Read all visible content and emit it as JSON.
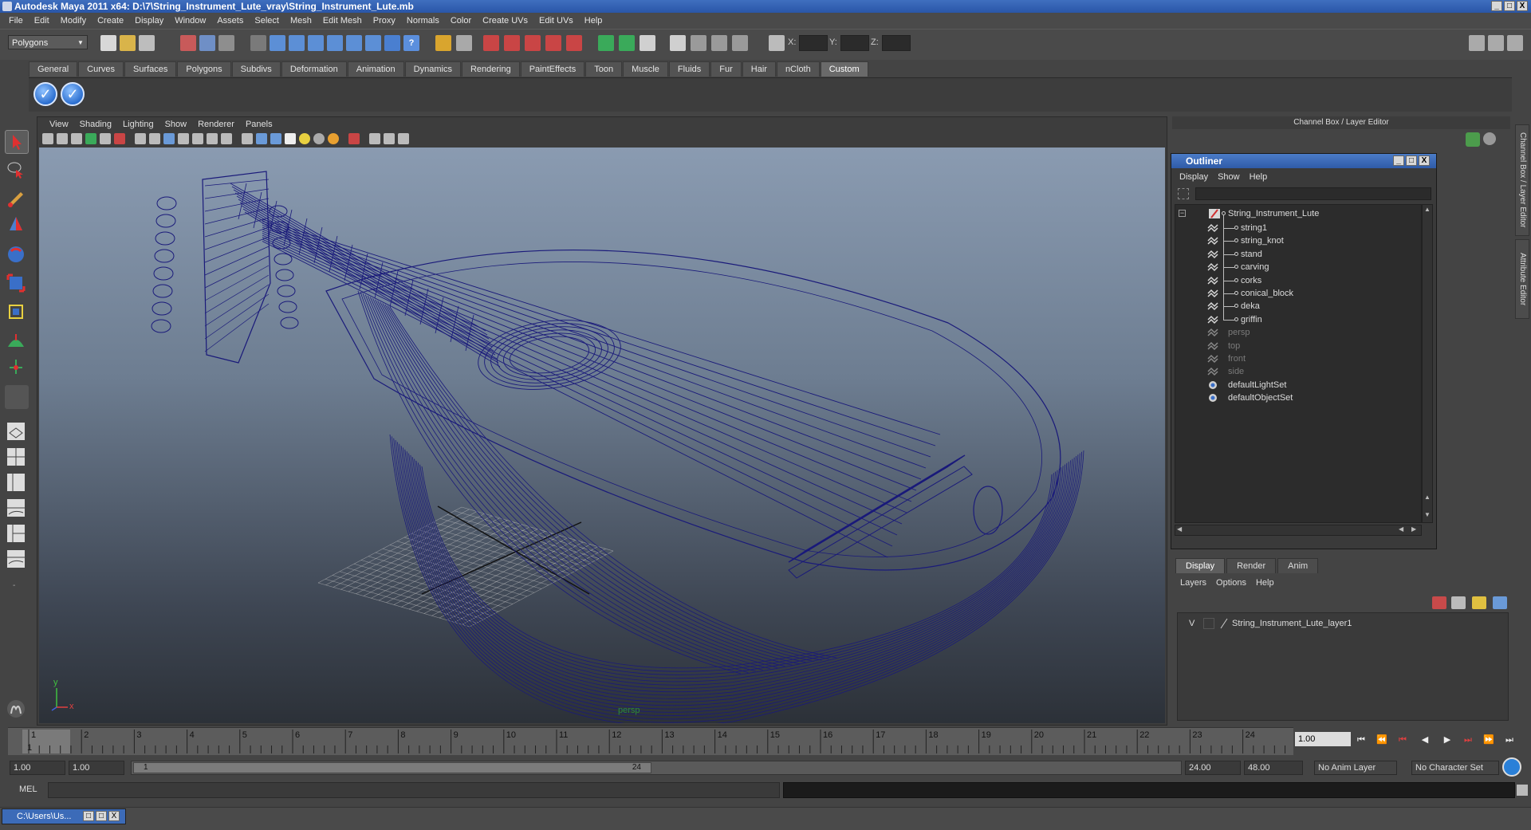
{
  "window": {
    "title": "Autodesk Maya 2011 x64: D:\\7\\String_Instrument_Lute_vray\\String_Instrument_Lute.mb",
    "buttons": [
      "_",
      "□",
      "X"
    ]
  },
  "menus": [
    "File",
    "Edit",
    "Modify",
    "Create",
    "Display",
    "Window",
    "Assets",
    "Select",
    "Mesh",
    "Edit Mesh",
    "Proxy",
    "Normals",
    "Color",
    "Create UVs",
    "Edit UVs",
    "Help"
  ],
  "status_line": {
    "mode": "Polygons",
    "x_label": "X:",
    "y_label": "Y:",
    "z_label": "Z:"
  },
  "shelf": {
    "tabs": [
      "General",
      "Curves",
      "Surfaces",
      "Polygons",
      "Subdivs",
      "Deformation",
      "Animation",
      "Dynamics",
      "Rendering",
      "PaintEffects",
      "Toon",
      "Muscle",
      "Fluids",
      "Fur",
      "Hair",
      "nCloth",
      "Custom"
    ],
    "active_tab": "Custom"
  },
  "viewport": {
    "menus": [
      "View",
      "Shading",
      "Lighting",
      "Show",
      "Renderer",
      "Panels"
    ],
    "camera": "persp",
    "axis_y": "y",
    "axis_x": "x",
    "colors": {
      "wireframe": "#1a1a7a",
      "grid": "#c8c8c8"
    }
  },
  "channel_box": {
    "title": "Channel Box / Layer Editor",
    "side_tabs": [
      "Channel Box / Layer Editor",
      "Attribute Editor"
    ]
  },
  "outliner": {
    "title": "Outliner",
    "menus": [
      "Display",
      "Show",
      "Help"
    ],
    "root": "String_Instrument_Lute",
    "children": [
      "string1",
      "string_knot",
      "stand",
      "carving",
      "corks",
      "conical_block",
      "deka",
      "griffin"
    ],
    "cameras": [
      "persp",
      "top",
      "front",
      "side"
    ],
    "sets": [
      "defaultLightSet",
      "defaultObjectSet"
    ]
  },
  "layer_editor": {
    "tabs": [
      "Display",
      "Render",
      "Anim"
    ],
    "active_tab": "Display",
    "menus": [
      "Layers",
      "Options",
      "Help"
    ],
    "layer_visibility": "V",
    "layer_name": "String_Instrument_Lute_layer1"
  },
  "timeline": {
    "ticks": [
      "1",
      "2",
      "3",
      "4",
      "5",
      "6",
      "7",
      "8",
      "9",
      "10",
      "11",
      "12",
      "13",
      "14",
      "15",
      "16",
      "17",
      "18",
      "19",
      "20",
      "21",
      "22",
      "23",
      "24"
    ],
    "current_frame_marker": "1",
    "current_time": "1.00"
  },
  "range": {
    "start_time": "1.00",
    "playback_start": "1.00",
    "slider_start": "1",
    "slider_end": "24",
    "playback_end": "24.00",
    "end_time": "48.00",
    "anim_layer": "No Anim Layer",
    "character_set": "No Character Set"
  },
  "command_line": {
    "label": "MEL"
  },
  "taskbar": {
    "item": "C:\\Users\\Us..."
  }
}
